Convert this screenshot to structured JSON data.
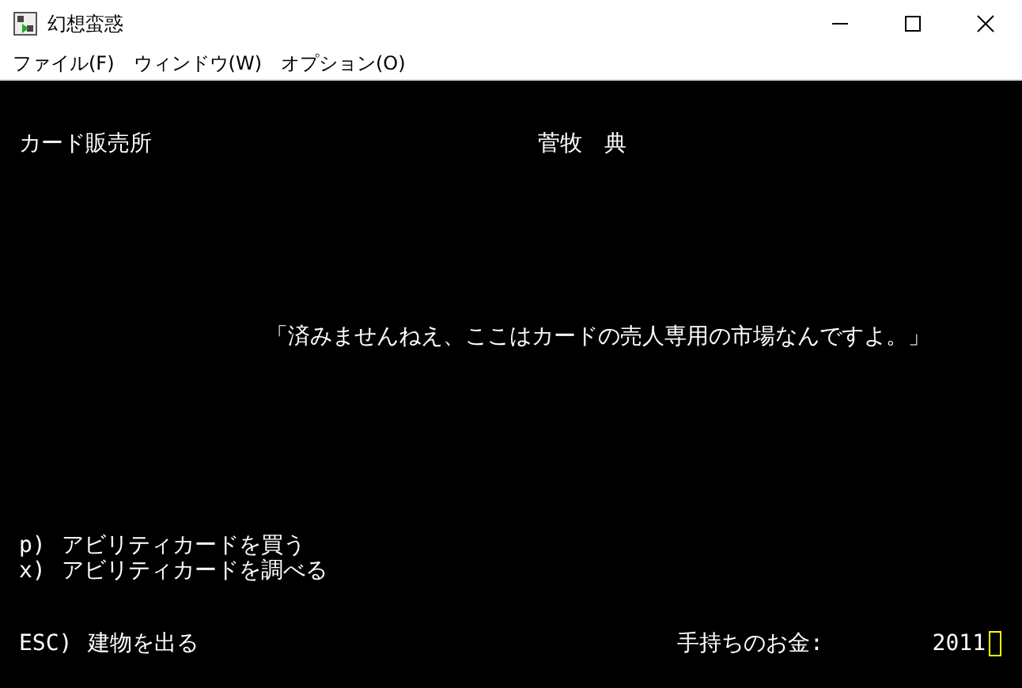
{
  "window": {
    "title": "幻想蛮惑"
  },
  "menu": [
    {
      "label": "ファイル(F)"
    },
    {
      "label": "ウィンドウ(W)"
    },
    {
      "label": "オプション(O)"
    }
  ],
  "screen": {
    "location": "カード販売所",
    "npc_name": "菅牧　典",
    "dialogue": "「済みませんねえ、ここはカードの売人専用の市場なんですよ。」",
    "options": [
      {
        "key": "p)",
        "label": "アビリティカードを買う"
      },
      {
        "key": "x)",
        "label": "アビリティカードを調べる"
      }
    ],
    "exit": {
      "key": "ESC)",
      "label": "建物を出る"
    },
    "money": {
      "label": "手持ちのお金:",
      "value": "2011"
    }
  }
}
